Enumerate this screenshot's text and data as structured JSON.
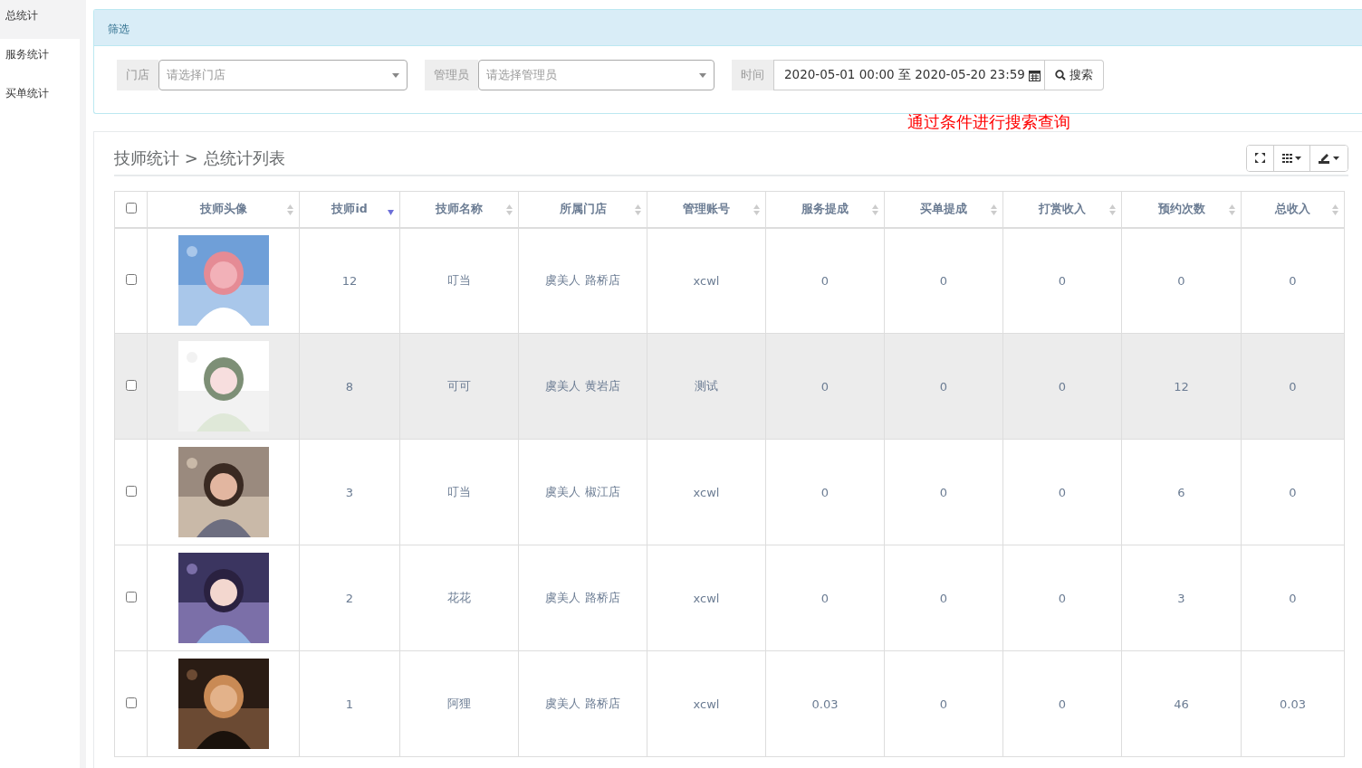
{
  "sidebar": {
    "items": [
      {
        "label": "总统计",
        "selected": true
      },
      {
        "label": "服务统计",
        "selected": false
      },
      {
        "label": "买单统计",
        "selected": false
      }
    ]
  },
  "filter": {
    "title": "筛选",
    "store": {
      "label": "门店",
      "placeholder": "请选择门店"
    },
    "manager": {
      "label": "管理员",
      "placeholder": "请选择管理员"
    },
    "time": {
      "label": "时间",
      "value": "2020-05-01 00:00 至 2020-05-20 23:59"
    },
    "search_button": "搜索"
  },
  "annotation": "通过条件进行搜索查询",
  "list": {
    "breadcrumb": "技师统计 > 总统计列表",
    "columns": [
      {
        "kind": "checkbox",
        "checked": false
      },
      {
        "kind": "label",
        "label": "技师头像",
        "sorted": false
      },
      {
        "kind": "label",
        "label": "技师id",
        "sorted": true
      },
      {
        "kind": "label",
        "label": "技师名称",
        "sorted": false
      },
      {
        "kind": "label",
        "label": "所属门店",
        "sorted": false
      },
      {
        "kind": "label",
        "label": "管理账号",
        "sorted": false
      },
      {
        "kind": "label",
        "label": "服务提成",
        "sorted": false
      },
      {
        "kind": "label",
        "label": "买单提成",
        "sorted": false
      },
      {
        "kind": "label",
        "label": "打赏收入",
        "sorted": false
      },
      {
        "kind": "label",
        "label": "预约次数",
        "sorted": false
      },
      {
        "kind": "label",
        "label": "总收入",
        "sorted": false
      }
    ],
    "rows": [
      {
        "highlighted": false,
        "cells": [
          {
            "kind": "checkbox",
            "checked": false
          },
          {
            "kind": "picture"
          },
          "12",
          "叮当",
          "虞美人 路桥店",
          "xcwl",
          "0",
          "0",
          "0",
          "0",
          "0"
        ]
      },
      {
        "highlighted": true,
        "cells": [
          {
            "kind": "checkbox",
            "checked": false
          },
          {
            "kind": "picture"
          },
          "8",
          "可可",
          "虞美人 黄岩店",
          "测试",
          "0",
          "0",
          "0",
          "12",
          "0"
        ]
      },
      {
        "highlighted": false,
        "cells": [
          {
            "kind": "checkbox",
            "checked": false
          },
          {
            "kind": "picture"
          },
          "3",
          "叮当",
          "虞美人 椒江店",
          "xcwl",
          "0",
          "0",
          "0",
          "6",
          "0"
        ]
      },
      {
        "highlighted": false,
        "cells": [
          {
            "kind": "checkbox",
            "checked": false
          },
          {
            "kind": "picture"
          },
          "2",
          "花花",
          "虞美人 路桥店",
          "xcwl",
          "0",
          "0",
          "0",
          "3",
          "0"
        ]
      },
      {
        "highlighted": false,
        "cells": [
          {
            "kind": "checkbox",
            "checked": false
          },
          {
            "kind": "picture"
          },
          "1",
          "阿狸",
          "虞美人 路桥店",
          "xcwl",
          "0.03",
          "0",
          "0",
          "46",
          "0.03"
        ]
      }
    ]
  }
}
